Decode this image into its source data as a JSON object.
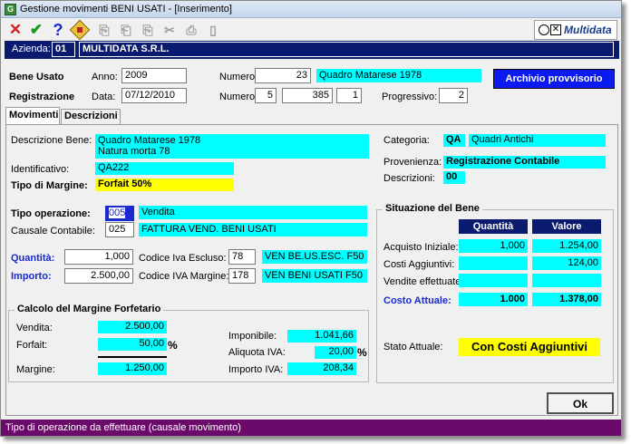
{
  "window": {
    "title": "Gestione movimenti BENI USATI - [Inserimento]",
    "app_icon": "app-icon"
  },
  "toolbar": {
    "icons": [
      "close-icon",
      "confirm-icon",
      "help-icon",
      "edit-icon",
      "toolbar-icon-5",
      "toolbar-icon-6",
      "toolbar-icon-7",
      "toolbar-icon-8",
      "toolbar-icon-9",
      "toolbar-icon-10"
    ]
  },
  "logo": {
    "text": "Multidata"
  },
  "azienda": {
    "label": "Azienda:",
    "code": "01",
    "name": "MULTIDATA S.R.L."
  },
  "header": {
    "bene_usato_label": "Bene Usato",
    "anno_label": "Anno:",
    "anno": "2009",
    "numero_label": "Numero:",
    "numero": "23",
    "bene_desc": "Quadro Matarese 1978",
    "archivio_button": "Archivio provvisorio",
    "registrazione_label": "Registrazione",
    "data_label": "Data:",
    "data": "07/12/2010",
    "numero2_label": "Numero:",
    "num_a": "5",
    "num_b": "385",
    "num_c": "1",
    "progressivo_label": "Progressivo:",
    "progressivo": "2"
  },
  "tabs": [
    {
      "label": "Movimenti"
    },
    {
      "label": "Descrizioni"
    }
  ],
  "bene": {
    "descrizione_label": "Descrizione Bene:",
    "descrizione_line1": "Quadro Matarese 1978",
    "descrizione_line2": "Natura morta 78",
    "identificativo_label": "Identificativo:",
    "identificativo": "QA222",
    "tipo_margine_label": "Tipo di Margine:",
    "tipo_margine": "Forfait 50%",
    "categoria_label": "Categoria:",
    "categoria_code": "QA",
    "categoria_desc": "Quadri Antichi",
    "provenienza_label": "Provenienza:",
    "provenienza": "Registrazione Contabile",
    "descrizioni_label": "Descrizioni:",
    "descrizioni": "00"
  },
  "operazione": {
    "tipo_label": "Tipo operazione:",
    "tipo_code": "005",
    "tipo_desc": "Vendita",
    "causale_label": "Causale Contabile:",
    "causale_code": "025",
    "causale_desc": "FATTURA VEND. BENI USATI",
    "quantita_label": "Quantità:",
    "quantita": "1,000",
    "importo_label": "Importo:",
    "importo": "2.500,00",
    "codice_esc_label": "Codice Iva Escluso:",
    "codice_esc": "78",
    "codice_esc_desc": "VEN BE.US.ESC. F50",
    "codice_marg_label": "Codice IVA Margine:",
    "codice_marg": "178",
    "codice_marg_desc": "VEN BENI USATI F50"
  },
  "calcolo": {
    "title": "Calcolo del Margine Forfetario",
    "vendita_label": "Vendita:",
    "vendita": "2.500,00",
    "forfait_label": "Forfait:",
    "forfait": "50,00",
    "percent": "%",
    "margine_label": "Margine:",
    "margine": "1.250,00",
    "imponibile_label": "Imponibile:",
    "imponibile": "1.041,66",
    "aliquota_label": "Aliquota IVA:",
    "aliquota": "20,00",
    "aliquota_percent": "%",
    "importo_iva_label": "Importo IVA:",
    "importo_iva": "208,34"
  },
  "situazione": {
    "title": "Situazione del Bene",
    "col_quantita": "Quantità",
    "col_valore": "Valore",
    "rows": [
      {
        "label": "Acquisto Iniziale:",
        "quantita": "1,000",
        "valore": "1.254,00"
      },
      {
        "label": "Costi Aggiuntivi:",
        "quantita": "",
        "valore": "124,00"
      },
      {
        "label": "Vendite effettuate:",
        "quantita": "",
        "valore": ""
      }
    ],
    "costo_label": "Costo Attuale:",
    "costo_quantita": "1.000",
    "costo_valore": "1.378,00",
    "stato_label": "Stato Attuale:",
    "stato": "Con Costi Aggiuntivi"
  },
  "ok_button": "Ok",
  "status": "Tipo di operazione da effettuare (causale movimento)",
  "colors": {
    "cyan": "#00ffff",
    "yellow": "#ffff00",
    "navy": "#0a1a6e",
    "status_bar": "#6c0a6c",
    "blue_button": "#0a1af0"
  }
}
